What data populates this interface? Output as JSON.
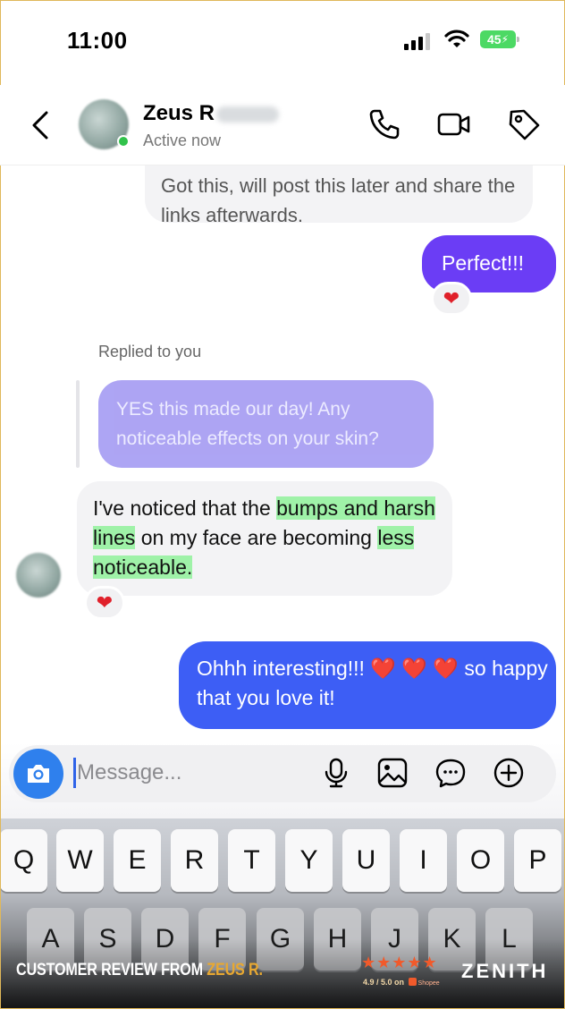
{
  "status_bar": {
    "time": "11:00",
    "battery": "45"
  },
  "header": {
    "contact_name": "Zeus R",
    "status": "Active now",
    "icons": [
      "back-arrow-icon",
      "phone-icon",
      "video-camera-icon",
      "tag-icon"
    ]
  },
  "messages": {
    "incoming_old": "Got this, will post this later and share the links afterwards.",
    "outgoing_perfect": "Perfect!!!",
    "reaction": "❤",
    "replied_label": "Replied to you",
    "reply_quote": "YES this made our day! Any noticeable effects on your skin?",
    "incoming_main": {
      "t1": "I've noticed that the ",
      "h1": "bumps and harsh lines",
      "t2": " on my face are becoming ",
      "h2": "less noticeable."
    },
    "outgoing_ohhh": {
      "t1": "Ohhh interesting!!! ",
      "hearts": "❤️ ❤️ ❤️",
      "t2": " so happy that you love it!"
    }
  },
  "composer": {
    "placeholder": "Message...",
    "icons": [
      "camera-icon",
      "microphone-icon",
      "image-icon",
      "chat-bubble-icon",
      "plus-circle-icon"
    ]
  },
  "keyboard": {
    "row1": [
      "Q",
      "W",
      "E",
      "R",
      "T",
      "Y",
      "U",
      "I",
      "O",
      "P"
    ],
    "row2": [
      "A",
      "S",
      "D",
      "F",
      "G",
      "H",
      "J",
      "K",
      "L"
    ]
  },
  "overlay": {
    "caption_prefix": "CUSTOMER REVIEW FROM ",
    "caption_name": "ZEUS R.",
    "stars": "★★★★★",
    "rating_text": "4.9 / 5.0 on",
    "shopee": "Shopee",
    "brand": "ZENITH"
  },
  "colors": {
    "outgoing_purple": "#6b3df5",
    "outgoing_blue": "#3d5ef5",
    "highlight_green": "#9ff2a8",
    "online_green": "#31c24b",
    "battery_green": "#4cd964"
  }
}
